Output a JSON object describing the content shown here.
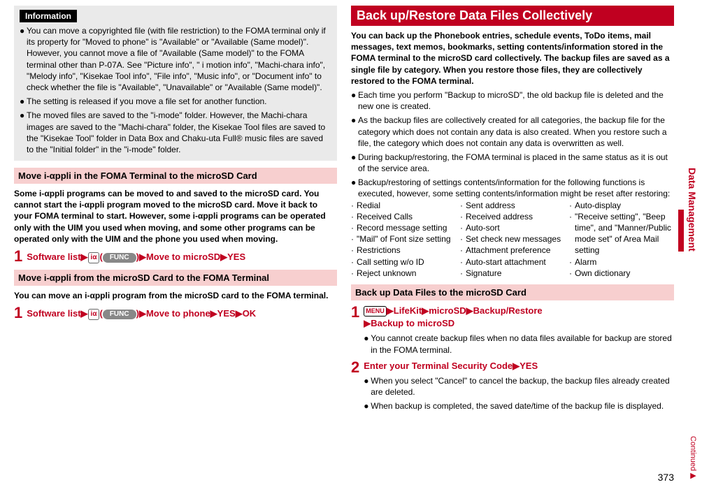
{
  "left": {
    "info_label": "Information",
    "info_bullets": [
      "You can move a copyrighted file (with file restriction) to the FOMA terminal only if its property for \"Moved to phone\" is \"Available\" or \"Available (Same model)\". However, you cannot move a file of \"Available (Same model)\" to the FOMA terminal other than P-07A. See \"Picture info\", \" i motion info\", \"Machi-chara info\", \"Melody info\", \"Kisekae Tool info\", \"File info\", \"Music info\", or \"Document info\" to check whether the file is \"Available\", \"Unavailable\" or \"Available (Same model)\".",
      "The setting is released if you move a file set for another function.",
      "The moved files are saved to the \"i-mode\" folder. However, the Machi-chara images are saved to the \"Machi-chara\" folder, the Kisekae Tool files are saved to the \"Kisekae Tool\" folder in Data Box and Chaku-uta Full® music files are saved to the \"Initial folder\" in the \"i-mode\" folder."
    ],
    "section1_title": "Move i-αppli in the FOMA Terminal to the microSD Card",
    "section1_para": "Some i-αppli programs can be moved to and saved to the microSD card. You cannot start the i-αppli program moved to the microSD card. Move it back to your FOMA terminal to start. However, some i-αppli programs can be operated only with the UIM you used when moving, and some other programs can be operated only with the UIM and the phone you used when moving.",
    "step1_num": "1",
    "step1_a": "Software list",
    "step1_func": "FUNC",
    "step1_b": "Move to microSD",
    "step1_c": "YES",
    "section2_title": "Move i-αppli from the microSD Card to the FOMA Terminal",
    "section2_para": "You can move an i-αppli program from the microSD card to the FOMA terminal.",
    "step2_num": "1",
    "step2_a": "Software list",
    "step2_func": "FUNC",
    "step2_b": "Move to phone",
    "step2_c": "YES",
    "step2_d": "OK"
  },
  "right": {
    "title": "Back up/Restore Data Files Collectively",
    "intro": "You can back up the Phonebook entries, schedule events, ToDo items, mail messages, text memos, bookmarks, setting contents/information stored in the FOMA terminal to the microSD card collectively. The backup files are saved as a single file by category. When you restore those files, they are collectively restored to the FOMA terminal.",
    "bullets": [
      "Each time you perform \"Backup to microSD\", the old backup file is deleted and the new one is created.",
      "As the backup files are collectively created for all categories, the backup file for the category which does not contain any data is also created. When you restore such a file, the category which does not contain any data is overwritten as well.",
      "During backup/restoring, the FOMA terminal is placed in the same status as it is out of the service area.",
      "Backup/restoring of settings contents/information for the following functions is executed, however, some setting contents/information might be reset after restoring:"
    ],
    "col1": [
      "Redial",
      "Received Calls",
      "Record message setting",
      "\"Mail\" of Font size setting",
      "Restrictions",
      "Call setting w/o ID",
      "Reject unknown"
    ],
    "col2": [
      "Sent address",
      "Received address",
      "Auto-sort",
      "Set check new messages",
      "Attachment preference",
      "Auto-start attachment",
      "Signature"
    ],
    "col3": [
      "Auto-display",
      "\"Receive setting\", \"Beep time\", and \"Manner/Public mode set\" of Area Mail setting",
      "Alarm",
      "Own dictionary"
    ],
    "section_title": "Back up Data Files to the microSD Card",
    "s1_num": "1",
    "s1_menu": "MENU",
    "s1_a": "LifeKit",
    "s1_b": "microSD",
    "s1_c": "Backup/Restore",
    "s1_d": "Backup to microSD",
    "s1_note": "You cannot create backup files when no data files available for backup are stored in the FOMA terminal.",
    "s2_num": "2",
    "s2_a": "Enter your Terminal Security Code",
    "s2_b": "YES",
    "s2_notes": [
      "When you select \"Cancel\" to cancel the backup, the backup files already created are deleted.",
      "When backup is completed, the saved date/time of the backup file is displayed."
    ]
  },
  "side_tab": "Data Management",
  "page_num": "373",
  "continued": "Continued"
}
